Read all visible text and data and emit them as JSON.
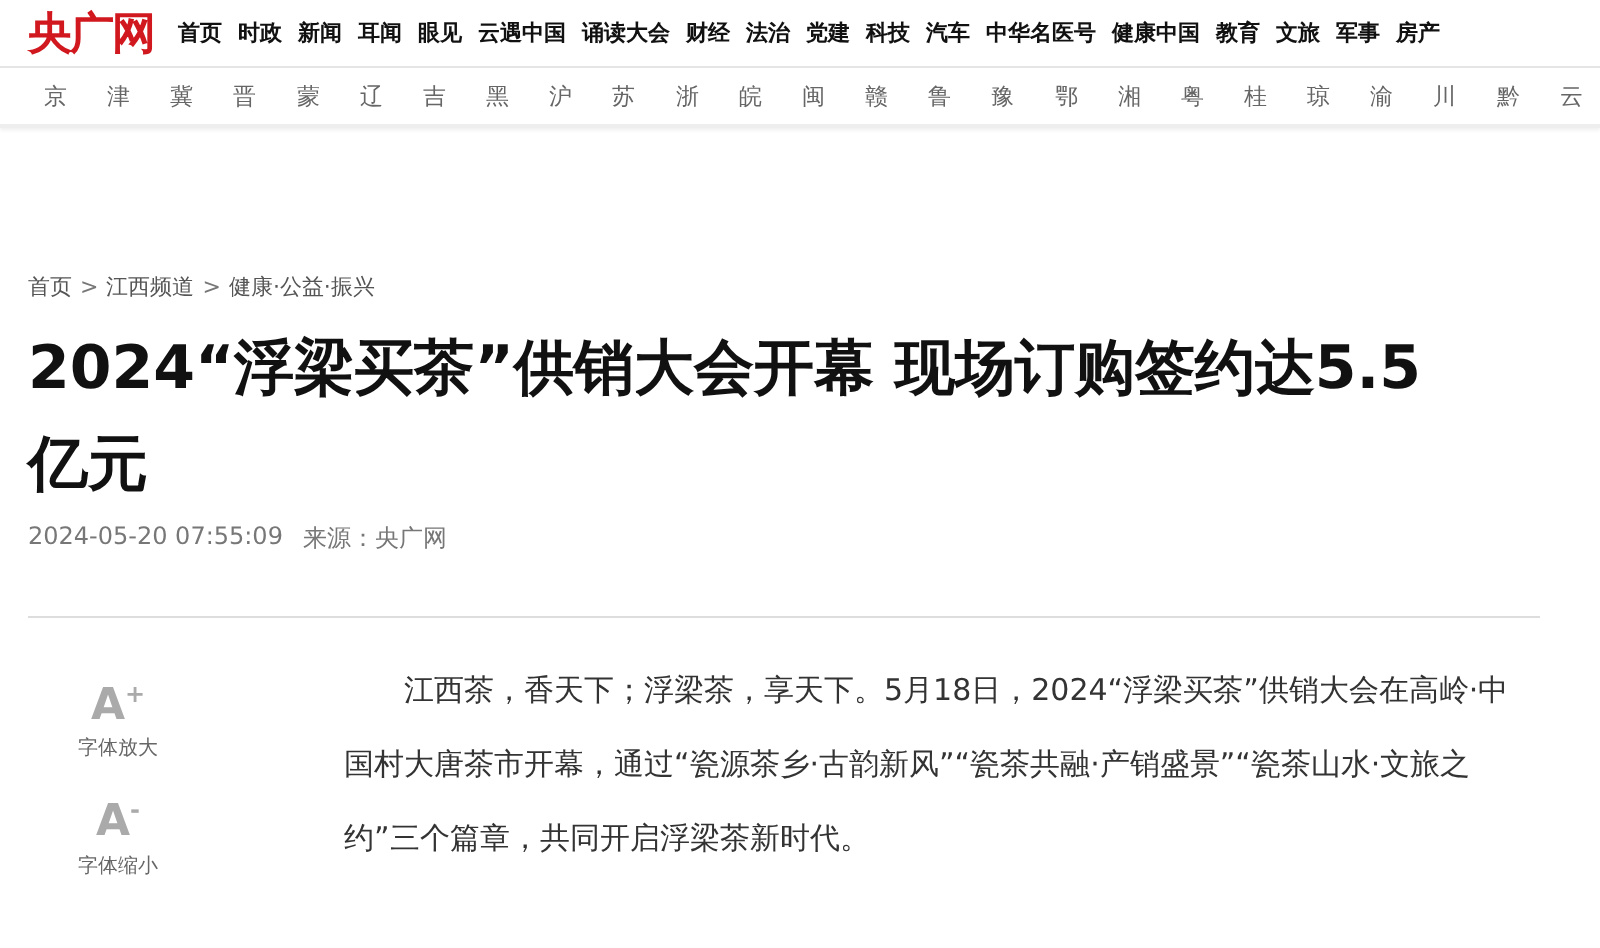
{
  "logo": "央广网",
  "nav": [
    "首页",
    "时政",
    "新闻",
    "耳闻",
    "眼见",
    "云遇中国",
    "诵读大会",
    "财经",
    "法治",
    "党建",
    "科技",
    "汽车",
    "中华名医号",
    "健康中国",
    "教育",
    "文旅",
    "军事",
    "房产"
  ],
  "provinces": [
    "京",
    "津",
    "冀",
    "晋",
    "蒙",
    "辽",
    "吉",
    "黑",
    "沪",
    "苏",
    "浙",
    "皖",
    "闽",
    "赣",
    "鲁",
    "豫",
    "鄂",
    "湘",
    "粤",
    "桂",
    "琼",
    "渝",
    "川",
    "黔",
    "云"
  ],
  "breadcrumb": [
    "首页",
    "江西频道",
    "健康·公益·振兴"
  ],
  "breadcrumb_separator": ">",
  "title": "2024“浮梁买茶”供销大会开幕 现场订购签约达5.5亿元",
  "date": "2024-05-20 07:55:09",
  "source": "来源：央广网",
  "font_tools": [
    {
      "symbol": "A$^{+}$",
      "label": "字体放大"
    },
    {
      "symbol": "A$^{-}$",
      "label": "字体缩小"
    }
  ],
  "body": "江西茶，香天下；浮梁茶，享天下。5月18日，2024“浮梁买茶”供销大会在高岭·中国村大唐茶市开幕，通过“瓷源茶乡·古韵新风”“瓷茶共融·产销盛景”“瓷茶山水·文旅之约”三个篇章，共同开启浮梁茶新时代。"
}
